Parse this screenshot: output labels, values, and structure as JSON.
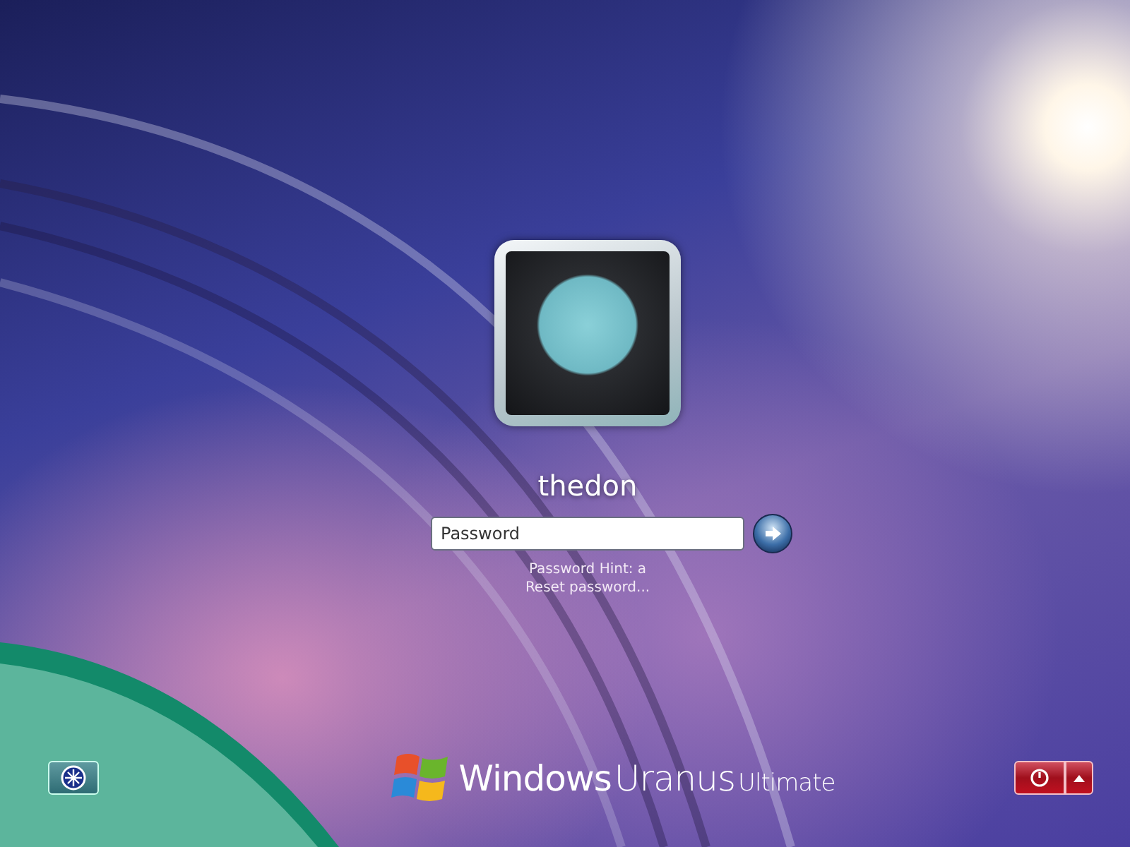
{
  "user": {
    "name": "thedon"
  },
  "password": {
    "placeholder": "Password"
  },
  "hint": "Password Hint: a",
  "reset_link": "Reset password...",
  "branding": {
    "windows": "Windows",
    "edition": "Uranus",
    "tier": "Ultimate"
  }
}
